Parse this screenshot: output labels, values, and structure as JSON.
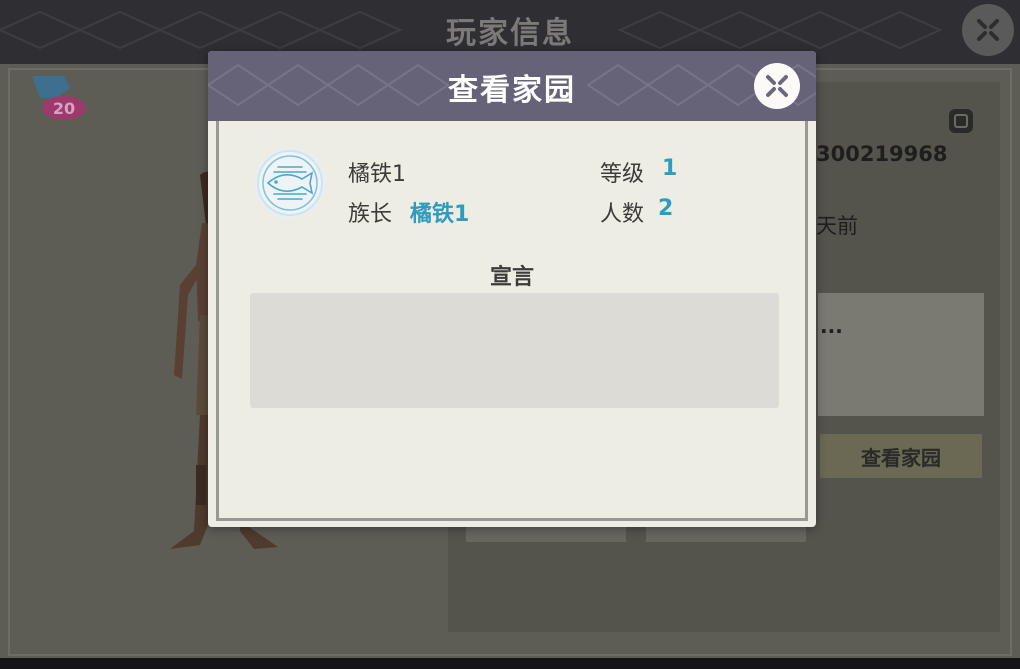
{
  "background_screen": {
    "title": "玩家信息",
    "player_id_partial": "300219968",
    "last_online_partial": "天前",
    "signature_partial": "...",
    "view_home_button": "查看家园",
    "level_badge": "20",
    "icons": {
      "close": "close-x-icon",
      "copy": "copy-icon"
    }
  },
  "modal": {
    "title": "查看家园",
    "home_name": "橘铁1",
    "leader_label": "族长",
    "leader_name": "橘铁1",
    "level_label": "等级",
    "level_value": "1",
    "members_label": "人数",
    "members_value": "2",
    "declaration_title": "宣言",
    "declaration_text": "",
    "emblem_icon": "fish-emblem-icon",
    "close_icon": "close-x-icon"
  },
  "colors": {
    "modal_header": "#666379",
    "modal_body": "#eeede4",
    "accent_value": "#2f9bc0",
    "overlay_bg": "#5e5d55"
  }
}
